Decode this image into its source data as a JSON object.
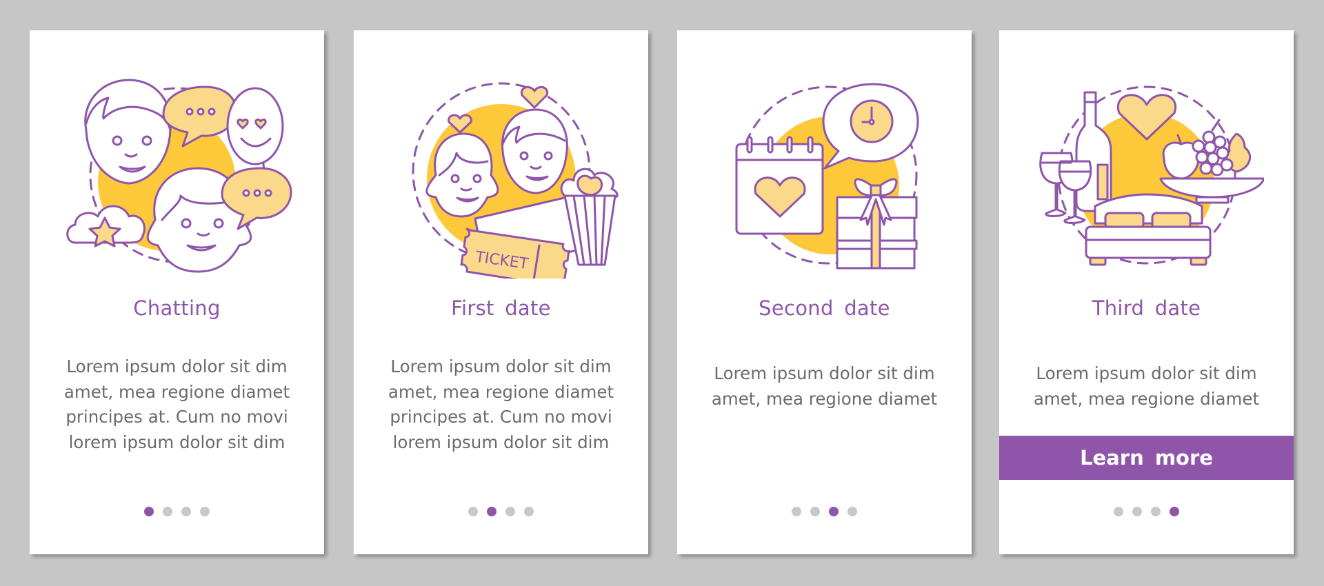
{
  "colors": {
    "background": "#c6c6c6",
    "card": "#ffffff",
    "accent_purple": "#8e55ab",
    "accent_yellow": "#fdc93a",
    "light_yellow": "#fbd98b",
    "text_gray": "#6b6b6b",
    "dot_inactive": "#c8c8c8"
  },
  "screens": [
    {
      "illustration": "chatting-illustration",
      "title": "Chatting",
      "body_lines": [
        "Lorem ipsum dolor sit dim",
        "amet, mea regione diamet",
        "principes at. Cum no movi",
        "lorem ipsum dolor sit dim"
      ],
      "active_step": 1,
      "total_steps": 4
    },
    {
      "illustration": "first-date-illustration",
      "title": "First date",
      "ticket_label": "TICKET",
      "body_lines": [
        "Lorem ipsum dolor sit dim",
        "amet, mea regione diamet",
        "principes at. Cum no movi",
        "lorem ipsum dolor sit dim"
      ],
      "active_step": 2,
      "total_steps": 4
    },
    {
      "illustration": "second-date-illustration",
      "title": "Second date",
      "body_lines": [
        "Lorem ipsum dolor sit dim",
        "amet, mea regione diamet"
      ],
      "active_step": 3,
      "total_steps": 4
    },
    {
      "illustration": "third-date-illustration",
      "title": "Third date",
      "body_lines": [
        "Lorem ipsum dolor sit dim",
        "amet, mea regione diamet"
      ],
      "button_label": "Learn more",
      "active_step": 4,
      "total_steps": 4
    }
  ]
}
